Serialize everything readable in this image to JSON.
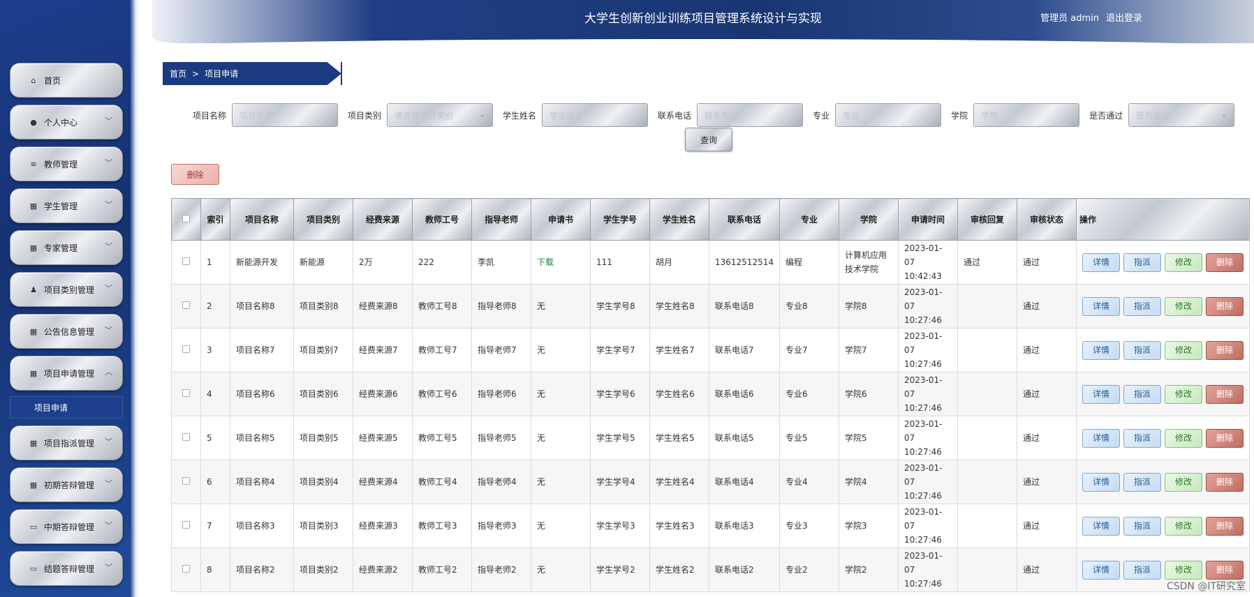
{
  "header": {
    "title": "大学生创新创业训练项目管理系统设计与实现",
    "user": "管理员 admin",
    "logout": "退出登录"
  },
  "sidebar": {
    "items": [
      {
        "label": "首页",
        "icon": "home-icon"
      },
      {
        "label": "个人中心",
        "icon": "user-icon"
      },
      {
        "label": "教师管理",
        "icon": "list-icon"
      },
      {
        "label": "学生管理",
        "icon": "grid-icon"
      },
      {
        "label": "专家管理",
        "icon": "grid-icon"
      },
      {
        "label": "项目类别管理",
        "icon": "person-icon"
      },
      {
        "label": "公告信息管理",
        "icon": "grid-icon"
      },
      {
        "label": "项目申请管理",
        "icon": "grid-icon"
      },
      {
        "label": "项目指派管理",
        "icon": "grid-icon"
      },
      {
        "label": "初期答辩管理",
        "icon": "grid-icon"
      },
      {
        "label": "中期答辩管理",
        "icon": "monitor-icon"
      },
      {
        "label": "结题答辩管理",
        "icon": "monitor-icon"
      }
    ],
    "subitem": "项目申请"
  },
  "breadcrumb": {
    "home": "首页",
    "sep": ">",
    "current": "项目申请"
  },
  "filters": {
    "name_label": "项目名称",
    "name_placeholder": "项目名称",
    "type_label": "项目类别",
    "type_placeholder": "请选择项目类别",
    "student_label": "学生姓名",
    "student_placeholder": "学生姓名",
    "phone_label": "联系电话",
    "phone_placeholder": "联系电话",
    "major_label": "专业",
    "major_placeholder": "专业",
    "college_label": "学院",
    "college_placeholder": "学院",
    "pass_label": "是否通过",
    "pass_placeholder": "是否通过",
    "query": "查询"
  },
  "delete_button": "删除",
  "table": {
    "headers": [
      "索引",
      "项目名称",
      "项目类别",
      "经费来源",
      "教师工号",
      "指导老师",
      "申请书",
      "学生学号",
      "学生姓名",
      "联系电话",
      "专业",
      "学院",
      "申请时间",
      "审核回复",
      "审核状态",
      "操作"
    ],
    "actions": {
      "detail": "详情",
      "assign": "指派",
      "edit": "修改",
      "delete": "删除"
    },
    "rows": [
      [
        "1",
        "新能源开发",
        "新能源",
        "2万",
        "222",
        "李凯",
        "下载",
        "111",
        "胡月",
        "13612512514",
        "编程",
        "计算机应用技术学院",
        "2023-01-07 10:42:43",
        "通过",
        "通过"
      ],
      [
        "2",
        "项目名称8",
        "项目类别8",
        "经费来源8",
        "教师工号8",
        "指导老师8",
        "无",
        "学生学号8",
        "学生姓名8",
        "联系电话8",
        "专业8",
        "学院8",
        "2023-01-07 10:27:46",
        "",
        "通过"
      ],
      [
        "3",
        "项目名称7",
        "项目类别7",
        "经费来源7",
        "教师工号7",
        "指导老师7",
        "无",
        "学生学号7",
        "学生姓名7",
        "联系电话7",
        "专业7",
        "学院7",
        "2023-01-07 10:27:46",
        "",
        "通过"
      ],
      [
        "4",
        "项目名称6",
        "项目类别6",
        "经费来源6",
        "教师工号6",
        "指导老师6",
        "无",
        "学生学号6",
        "学生姓名6",
        "联系电话6",
        "专业6",
        "学院6",
        "2023-01-07 10:27:46",
        "",
        "通过"
      ],
      [
        "5",
        "项目名称5",
        "项目类别5",
        "经费来源5",
        "教师工号5",
        "指导老师5",
        "无",
        "学生学号5",
        "学生姓名5",
        "联系电话5",
        "专业5",
        "学院5",
        "2023-01-07 10:27:46",
        "",
        "通过"
      ],
      [
        "6",
        "项目名称4",
        "项目类别4",
        "经费来源4",
        "教师工号4",
        "指导老师4",
        "无",
        "学生学号4",
        "学生姓名4",
        "联系电话4",
        "专业4",
        "学院4",
        "2023-01-07 10:27:46",
        "",
        "通过"
      ],
      [
        "7",
        "项目名称3",
        "项目类别3",
        "经费来源3",
        "教师工号3",
        "指导老师3",
        "无",
        "学生学号3",
        "学生姓名3",
        "联系电话3",
        "专业3",
        "学院3",
        "2023-01-07 10:27:46",
        "",
        "通过"
      ],
      [
        "8",
        "项目名称2",
        "项目类别2",
        "经费来源2",
        "教师工号2",
        "指导老师2",
        "无",
        "学生学号2",
        "学生姓名2",
        "联系电话2",
        "专业2",
        "学院2",
        "2023-01-07 10:27:46",
        "",
        "通过"
      ]
    ]
  },
  "watermark": "CSDN @IT研究室"
}
